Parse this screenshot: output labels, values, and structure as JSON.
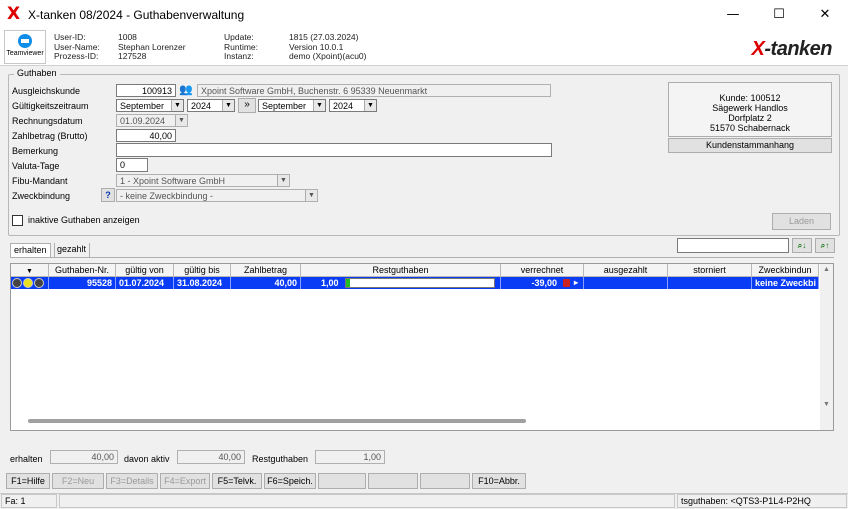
{
  "window": {
    "title": "X-tanken 08/2024 - Guthabenverwaltung",
    "minimize": "—",
    "maximize": "☐",
    "close": "✕"
  },
  "teamviewer": {
    "label": "Teamviewer"
  },
  "info": {
    "user_id_label": "User-ID:",
    "user_id": "1008",
    "user_name_label": "User-Name:",
    "user_name": "Stephan Lorenzer",
    "prozess_id_label": "Prozess-ID:",
    "prozess_id": "127528",
    "update_label": "Update:",
    "update": "1815 (27.03.2024)",
    "runtime_label": "Runtime:",
    "runtime": "Version 10.0.1",
    "instanz_label": "Instanz:",
    "instanz": "demo (Xpoint)(acu0)"
  },
  "brand": {
    "x": "X",
    "rest": "-tanken"
  },
  "form": {
    "group_title": "Guthaben",
    "ausgleichskunde_label": "Ausgleichskunde",
    "ausgleichskunde": "100913",
    "kunde_adresse": "Xpoint Software GmbH, Buchenstr. 6 95339 Neuenmarkt",
    "gueltigkeit_label": "Gültigkeitszeitraum",
    "von_monat": "September",
    "von_jahr": "2024",
    "bis_monat": "September",
    "bis_jahr": "2024",
    "rechnungsdatum_label": "Rechnungsdatum",
    "rechnungsdatum": "01.09.2024",
    "zahlbetrag_label": "Zahlbetrag (Brutto)",
    "zahlbetrag": "40,00",
    "bemerkung_label": "Bemerkung",
    "bemerkung": "",
    "valuta_label": "Valuta-Tage",
    "valuta": "0",
    "fibu_label": "Fibu-Mandant",
    "fibu": "1 - Xpoint Software GmbH",
    "zweck_label": "Zweckbindung",
    "zweck_help": "?",
    "zweck": "- keine Zweckbindung -",
    "inaktive_label": "inaktive Guthaben anzeigen",
    "laden": "Laden"
  },
  "kunde_box": {
    "line1": "Kunde: 100512",
    "line2": "Sägewerk Handlos",
    "line3": "Dorfplatz 2",
    "line4": "51570 Schabernack",
    "button": "Kundenstammanhang"
  },
  "tabs": [
    {
      "label": "erhalten"
    },
    {
      "label": "gezahlt"
    }
  ],
  "search_value": "",
  "table": {
    "headers": [
      "Guthaben-Nr.",
      "gültig von",
      "gültig bis",
      "Zahlbetrag",
      "Restguthaben",
      "verrechnet",
      "ausgezahlt",
      "storniert",
      "Zweckbindun"
    ],
    "rows": [
      {
        "nr": "95528",
        "von": "01.07.2024",
        "bis": "31.08.2024",
        "zahl": "40,00",
        "rest": "1,00",
        "rest_fraction": 0.025,
        "verrechnet": "-39,00",
        "ausgezahlt": "",
        "storniert": "",
        "zweck": "keine Zweckbi"
      }
    ]
  },
  "summary": {
    "erhalten_label": "erhalten",
    "erhalten": "40,00",
    "aktiv_label": "davon aktiv",
    "aktiv": "40,00",
    "rest_label": "Restguthaben",
    "rest": "1,00"
  },
  "fkeys": [
    {
      "label": "F1=Hilfe"
    },
    {
      "label": "F2=Neu"
    },
    {
      "label": "F3=Details"
    },
    {
      "label": "F4=Export"
    },
    {
      "label": "F5=Telvk."
    },
    {
      "label": "F6=Speich."
    },
    {
      "label": ""
    },
    {
      "label": ""
    },
    {
      "label": ""
    },
    {
      "label": "F10=Abbr."
    }
  ],
  "status": {
    "left": "Fa: 1",
    "right": "tsguthaben: <QTS3-P1L4-P2HQ"
  },
  "colors": {
    "selection": "#0a3cf5",
    "brand_red": "#dd0000",
    "progress": "#22bb22"
  }
}
